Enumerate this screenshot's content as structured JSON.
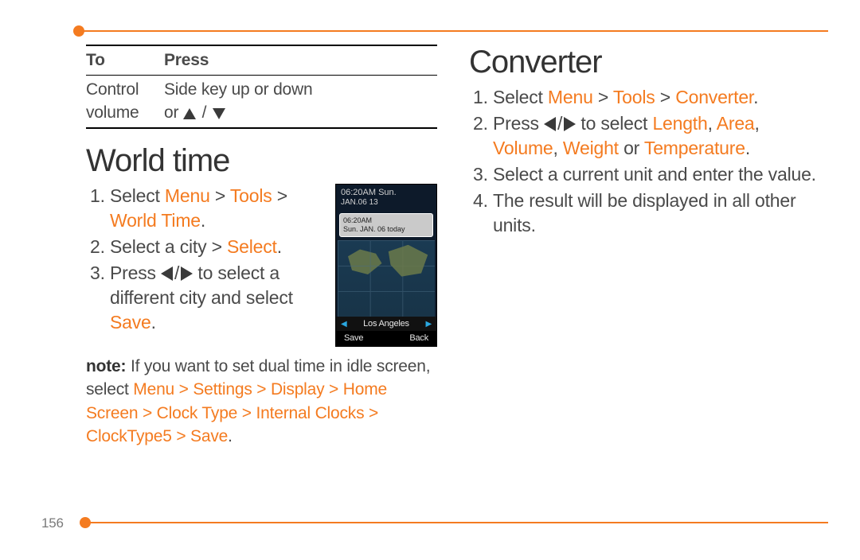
{
  "page_number": "156",
  "table": {
    "head_c1": "To",
    "head_c2": "Press",
    "row1_c1_l1": "Control",
    "row1_c1_l2": "volume",
    "row1_c2_l1": "Side key up or down",
    "row1_c2_l2a": "or ",
    "row1_c2_slash": "/"
  },
  "world_time": {
    "heading": "World time",
    "step1_a": "Select ",
    "step1_b": "Menu",
    "step1_c": " > ",
    "step1_d": "Tools",
    "step1_e": " > ",
    "step1_f": "World Time",
    "step1_g": ".",
    "step2_a": "Select a city > ",
    "step2_b": "Select",
    "step2_c": ".",
    "step3_a": "Press ",
    "step3_slash": "/",
    "step3_b": " to select a different city and select ",
    "step3_c": "Save",
    "step3_d": ".",
    "note_label": "note:",
    "note_a": " If you want to set dual time in idle screen, select ",
    "note_path": "Menu > Settings > Display > Home Screen > Clock Type > Internal Clocks > ClockType5 > Save",
    "note_end": "."
  },
  "thumb": {
    "top_line1": "06:20AM Sun.",
    "top_line2": "JAN.06 13",
    "card_line1": "06:20AM",
    "card_line2": "Sun. JAN. 06 today",
    "city": "Los Angeles",
    "soft_left": "Save",
    "soft_right": "Back"
  },
  "converter": {
    "heading": "Converter",
    "s1_a": "Select ",
    "s1_b": "Menu",
    "s1_c": " > ",
    "s1_d": "Tools",
    "s1_e": " > ",
    "s1_f": "Converter",
    "s1_g": ".",
    "s2_a": "Press ",
    "s2_slash": "/",
    "s2_b": " to select ",
    "s2_c": "Length",
    "s2_d": ", ",
    "s2_e": "Area",
    "s2_f": ", ",
    "s2_g": "Volume",
    "s2_h": ", ",
    "s2_i": "Weight",
    "s2_j": " or ",
    "s2_k": "Temperature",
    "s2_l": ".",
    "s3": "Select a current unit and enter the value.",
    "s4": "The result will be displayed in all other units."
  }
}
